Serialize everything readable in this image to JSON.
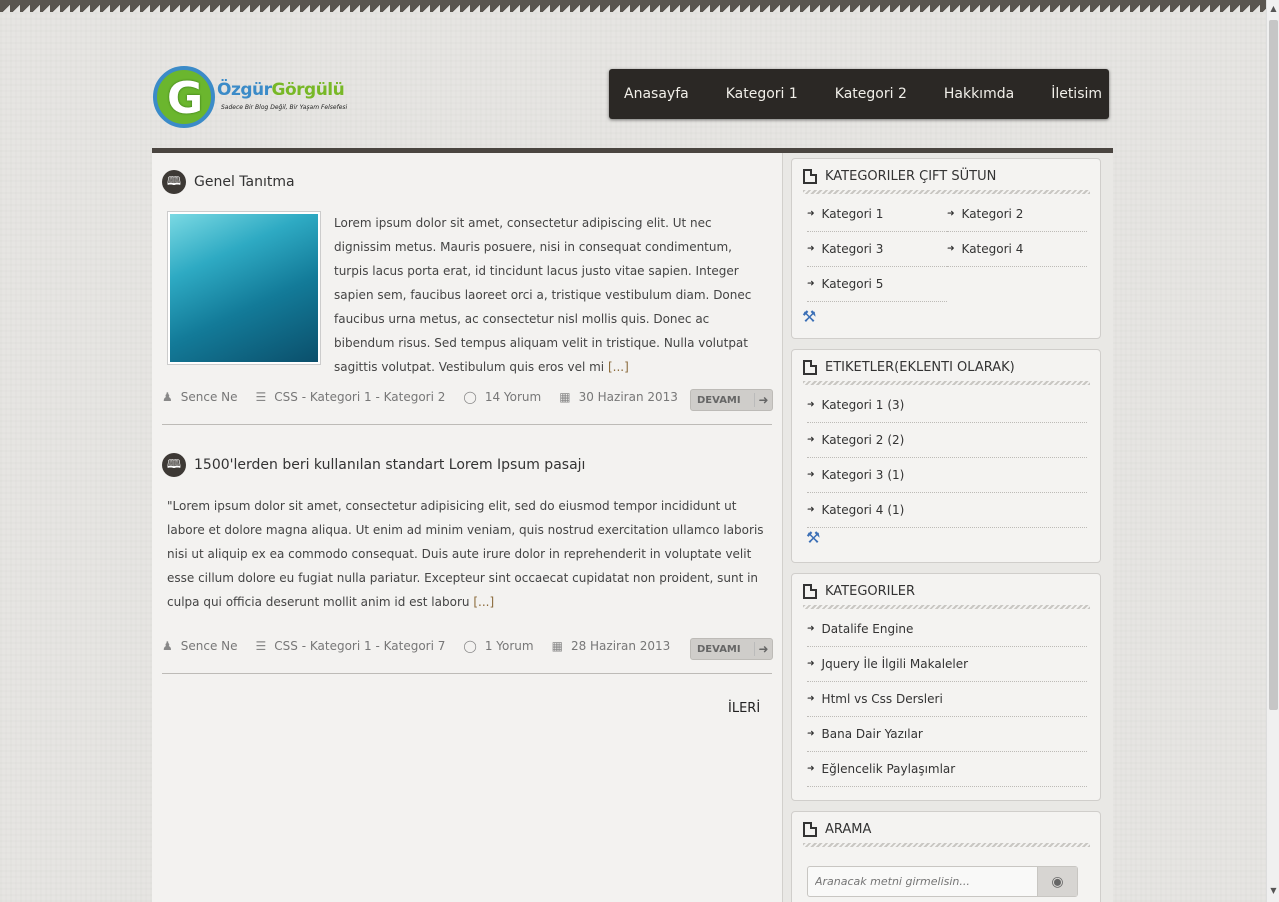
{
  "logo": {
    "letter": "G",
    "name_part1": "Özgür",
    "name_part2": "Görgülü",
    "tagline": "Sadece Bir Blog Değil, Bir Yaşam Felsefesi"
  },
  "nav": {
    "items": [
      "Anasayfa",
      "Kategori 1",
      "Kategori 2",
      "Hakkımda",
      "İletisim"
    ]
  },
  "posts": [
    {
      "title": "Genel Tanıtma",
      "excerpt": "Lorem ipsum dolor sit amet, consectetur adipiscing elit. Ut nec dignissim metus. Mauris posuere, nisi in consequat condimentum, turpis lacus porta erat, id tincidunt lacus justo vitae sapien. Integer sapien sem, faucibus laoreet orci a, tristique vestibulum diam. Donec faucibus urna metus, ac consectetur nisl mollis quis. Donec ac bibendum risus. Sed tempus aliquam velit in tristique. Nulla volutpat sagittis volutpat. Vestibulum quis eros vel mi",
      "more": "[...]",
      "author": "Sence Ne",
      "categories": "CSS - Kategori 1 - Kategori 2",
      "comments": "14 Yorum",
      "date": "30 Haziran 2013",
      "button": "DEVAMI"
    },
    {
      "title": "1500'lerden beri kullanılan standart Lorem Ipsum pasajı",
      "excerpt": "\"Lorem ipsum dolor sit amet, consectetur adipisicing elit, sed do eiusmod tempor incididunt ut labore et dolore magna aliqua. Ut enim ad minim veniam, quis nostrud exercitation ullamco laboris nisi ut aliquip ex ea commodo consequat. Duis aute irure dolor in reprehenderit in voluptate velit esse cillum dolore eu fugiat nulla pariatur. Excepteur sint occaecat cupidatat non proident, sunt in culpa qui officia deserunt mollit anim id est laboru",
      "more": "[...]",
      "author": "Sence Ne",
      "categories": "CSS - Kategori 1 - Kategori 7",
      "comments": "1 Yorum",
      "date": "28 Haziran 2013",
      "button": "DEVAMI"
    }
  ],
  "pagination": {
    "next": "İLERİ"
  },
  "widgets": {
    "categories_double": {
      "title": "KATEGORILER ÇIFT SÜTUN",
      "items": [
        "Kategori 1",
        "Kategori 2",
        "Kategori 3",
        "Kategori 4",
        "Kategori 5"
      ]
    },
    "tags": {
      "title": "ETIKETLER(EKLENTI OLARAK)",
      "items": [
        {
          "label": "Kategori 1",
          "count": "(3)"
        },
        {
          "label": "Kategori 2",
          "count": "(2)"
        },
        {
          "label": "Kategori 3",
          "count": "(1)"
        },
        {
          "label": "Kategori 4",
          "count": "(1)"
        }
      ]
    },
    "categories": {
      "title": "KATEGORILER",
      "items": [
        "Datalife Engine",
        "Jquery İle İlgili Makaleler",
        "Html vs Css Dersleri",
        "Bana Dair Yazılar",
        "Eğlencelik Paylaşımlar"
      ]
    },
    "search": {
      "title": "ARAMA",
      "placeholder": "Aranacak metni girmelisin..."
    }
  },
  "icons": {
    "post": "book-icon",
    "author": "user-icon",
    "categories": "list-icon",
    "comments": "comment-icon",
    "date": "calendar-icon",
    "arrow": "arrow-right-icon",
    "tools": "tools-icon",
    "search": "eye-icon"
  },
  "colors": {
    "nav_bg": "#2b2825",
    "logo_green": "#78b827",
    "logo_blue": "#3b8bc8"
  }
}
